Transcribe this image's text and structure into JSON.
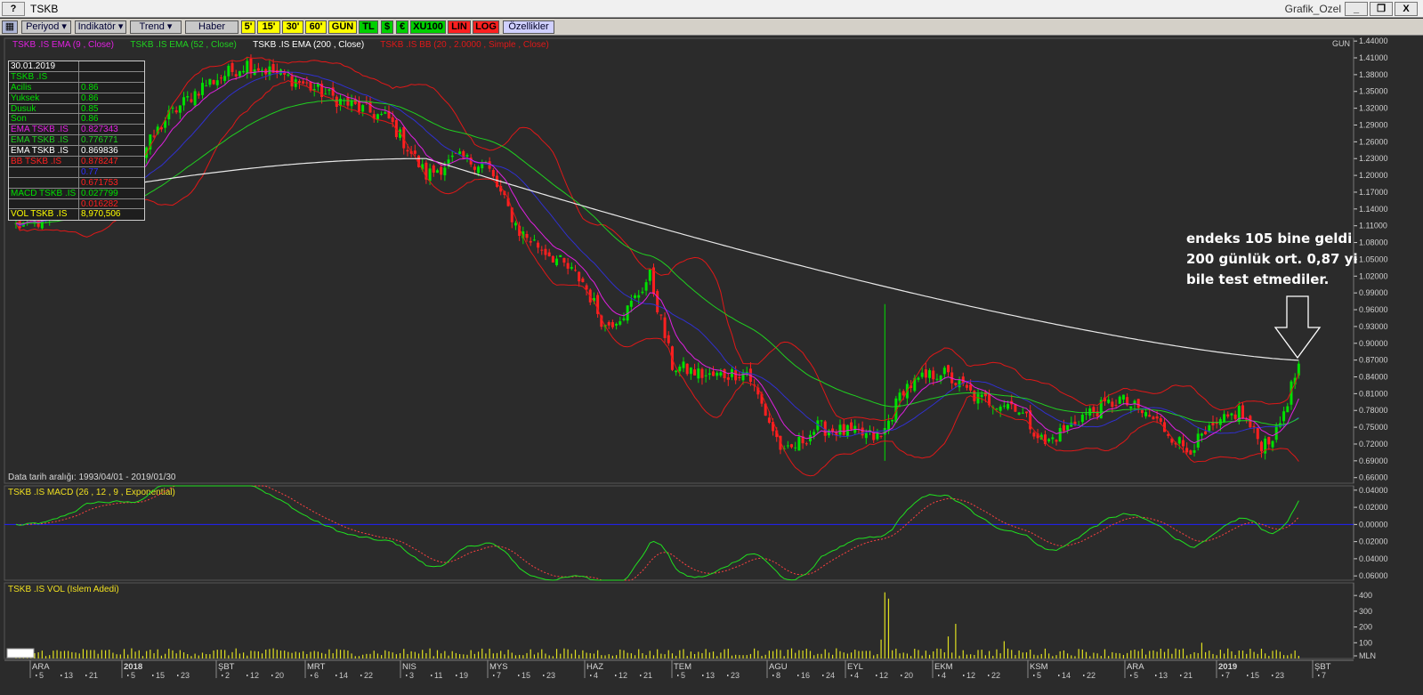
{
  "window": {
    "help_label": "?",
    "title": "TSKB",
    "subtitle": "Grafik_Ozel",
    "minimize_label": "_",
    "restore_label": "❐",
    "close_label": "X"
  },
  "toolbar": {
    "items": [
      {
        "label": "Periyod ▾",
        "style": "gray"
      },
      {
        "label": "Indikatör ▾",
        "style": "gray"
      },
      {
        "label": "Trend ▾",
        "style": "gray"
      },
      {
        "label": "Haber",
        "style": "gray"
      },
      {
        "label": "5'",
        "style": "yellow"
      },
      {
        "label": "15'",
        "style": "yellow"
      },
      {
        "label": "30'",
        "style": "yellow"
      },
      {
        "label": "60'",
        "style": "yellow"
      },
      {
        "label": "GÜN",
        "style": "yellow"
      },
      {
        "label": "TL",
        "style": "green"
      },
      {
        "label": "$",
        "style": "green"
      },
      {
        "label": "€",
        "style": "green"
      },
      {
        "label": "XU100",
        "style": "green"
      },
      {
        "label": "LIN",
        "style": "red"
      },
      {
        "label": "LOG",
        "style": "red"
      },
      {
        "label": "Özellikler",
        "style": "blue"
      }
    ]
  },
  "colors": {
    "bull": "#00e000",
    "bear": "#ff2020",
    "ema9": "#e020e0",
    "ema52": "#20d020",
    "ema200": "#e8e8e8",
    "bb": "#e01818",
    "bbmid": "#3030d0",
    "macd": "#20e020",
    "signal": "#ff4040",
    "zero": "#2020ff",
    "volume": "#e0e020",
    "grid": "#3a3a3a",
    "axis_text": "#d0d0d0"
  },
  "info_box": {
    "rows": [
      {
        "k": "30.01.2019",
        "v": "",
        "kc": "#ffffff",
        "vc": "#ffffff"
      },
      {
        "k": "TSKB .IS",
        "v": "",
        "kc": "#00e000",
        "vc": "#00e000"
      },
      {
        "k": " Acilis",
        "v": "0.86",
        "kc": "#00e000",
        "vc": "#00e000"
      },
      {
        "k": " Yuksek",
        "v": "0.86",
        "kc": "#00e000",
        "vc": "#00e000"
      },
      {
        "k": " Dusuk",
        "v": "0.85",
        "kc": "#00e000",
        "vc": "#00e000"
      },
      {
        "k": " Son",
        "v": "0.86",
        "kc": "#00e000",
        "vc": "#00e000"
      },
      {
        "k": "EMA TSKB .IS",
        "v": "0.827343",
        "kc": "#e020e0",
        "vc": "#e020e0"
      },
      {
        "k": "EMA TSKB .IS",
        "v": "0.776771",
        "kc": "#20d020",
        "vc": "#20d020"
      },
      {
        "k": "EMA TSKB .IS",
        "v": "0.869836",
        "kc": "#ffffff",
        "vc": "#ffffff"
      },
      {
        "k": "BB TSKB .IS",
        "v": "0.878247",
        "kc": "#ff2020",
        "vc": "#ff2020"
      },
      {
        "k": "",
        "v": "0.77",
        "kc": "#3030ff",
        "vc": "#3030ff"
      },
      {
        "k": "",
        "v": "0.671753",
        "kc": "#ff2020",
        "vc": "#ff2020"
      },
      {
        "k": "MACD TSKB .IS",
        "v": "0.027799",
        "kc": "#00e000",
        "vc": "#00e000"
      },
      {
        "k": "",
        "v": "0.016282",
        "kc": "#ff2020",
        "vc": "#ff2020"
      },
      {
        "k": "VOL TSKB .IS",
        "v": "8,970,506",
        "kc": "#ffff00",
        "vc": "#ffff00"
      }
    ]
  },
  "annotation": {
    "lines": [
      "endeks 105 bine geldi",
      "200 günlük ort. 0,87 yi",
      "bile test etmediler."
    ]
  },
  "chart_data": [
    {
      "type": "candlestick",
      "legend": [
        {
          "text": "TSKB .IS EMA (9 , Close)",
          "color": "#e020e0"
        },
        {
          "text": "TSKB .IS EMA (52 , Close)",
          "color": "#20d020"
        },
        {
          "text": "TSKB .IS EMA (200 , Close)",
          "color": "#ffffff"
        },
        {
          "text": "TSKB .IS BB (20 , 2.0000 , Simple , Close)",
          "color": "#e01818"
        }
      ],
      "period_label": "GUN",
      "date_range_text": "Data tarih aralığı: 1993/04/01 - 2019/01/30",
      "ylim": [
        0.65,
        1.445
      ],
      "yticks": [
        "1.44000",
        "1.41000",
        "1.38000",
        "1.35000",
        "1.32000",
        "1.29000",
        "1.26000",
        "1.23000",
        "1.20000",
        "1.17000",
        "1.14000",
        "1.11000",
        "1.08000",
        "1.05000",
        "1.02000",
        "0.99000",
        "0.96000",
        "0.93000",
        "0.90000",
        "0.87000",
        "0.84000",
        "0.81000",
        "0.78000",
        "0.75000",
        "0.72000",
        "0.69000",
        "0.66000"
      ],
      "close_anchors": [
        [
          0,
          1.11
        ],
        [
          8,
          1.12
        ],
        [
          18,
          1.18
        ],
        [
          30,
          1.2
        ],
        [
          40,
          1.3
        ],
        [
          50,
          1.36
        ],
        [
          62,
          1.4
        ],
        [
          75,
          1.37
        ],
        [
          88,
          1.33
        ],
        [
          100,
          1.3
        ],
        [
          110,
          1.2
        ],
        [
          118,
          1.23
        ],
        [
          126,
          1.22
        ],
        [
          135,
          1.1
        ],
        [
          145,
          1.05
        ],
        [
          152,
          1.01
        ],
        [
          158,
          0.93
        ],
        [
          164,
          0.96
        ],
        [
          170,
          1.02
        ],
        [
          176,
          0.86
        ],
        [
          186,
          0.84
        ],
        [
          196,
          0.85
        ],
        [
          206,
          0.7
        ],
        [
          215,
          0.75
        ],
        [
          224,
          0.74
        ],
        [
          232,
          0.73
        ],
        [
          238,
          0.82
        ],
        [
          248,
          0.85
        ],
        [
          258,
          0.8
        ],
        [
          268,
          0.79
        ],
        [
          276,
          0.72
        ],
        [
          286,
          0.77
        ],
        [
          296,
          0.8
        ],
        [
          306,
          0.76
        ],
        [
          314,
          0.71
        ],
        [
          322,
          0.75
        ],
        [
          328,
          0.78
        ],
        [
          334,
          0.72
        ],
        [
          338,
          0.74
        ],
        [
          344,
          0.86
        ]
      ],
      "ema200": {
        "start": 1.15,
        "peak": 1.23,
        "peak_i": 110,
        "end": 0.8698
      },
      "ema52_end": 0.7768,
      "ema9_end": 0.8273,
      "bb_end": {
        "upper": 0.8782,
        "mid": 0.77,
        "lower": 0.6718
      },
      "spikes": [
        [
          233,
          0.97,
          0.69
        ]
      ]
    },
    {
      "type": "line",
      "title": "TSKB .IS MACD (26 , 12 , 9 , Exponential)",
      "ylim": [
        -0.065,
        0.045
      ],
      "yticks": [
        "0.04000",
        "0.02000",
        "0.00000",
        "0.02000",
        "0.04000",
        "0.06000"
      ],
      "ytick_values": [
        0.04,
        0.02,
        0,
        -0.02,
        -0.04,
        -0.06
      ],
      "last": {
        "macd": 0.027799,
        "signal": 0.016282
      }
    },
    {
      "type": "bar",
      "title": "TSKB .IS VOL (Islem Adedi)",
      "ylim": [
        0,
        480
      ],
      "yticks": [
        "400",
        "300",
        "200",
        "100",
        "MLN"
      ],
      "ytick_values": [
        400,
        300,
        200,
        100,
        0
      ],
      "spikes": [
        [
          233,
          420
        ],
        [
          234,
          380
        ],
        [
          232,
          120
        ],
        [
          252,
          220
        ],
        [
          250,
          140
        ],
        [
          265,
          110
        ],
        [
          318,
          100
        ]
      ]
    }
  ],
  "x_axis": {
    "months": [
      {
        "label": "ARA",
        "x": 36,
        "days": [
          "5",
          "13",
          "21"
        ],
        "bold": false
      },
      {
        "label": "2018",
        "x": 139,
        "days": [
          "5",
          "15",
          "23"
        ],
        "bold": true
      },
      {
        "label": "ŞBT",
        "x": 245,
        "days": [
          "2",
          "12",
          "20"
        ],
        "bold": false
      },
      {
        "label": "MRT",
        "x": 345,
        "days": [
          "6",
          "14",
          "22"
        ],
        "bold": false
      },
      {
        "label": "NIS",
        "x": 452,
        "days": [
          "3",
          "11",
          "19"
        ],
        "bold": false
      },
      {
        "label": "MYS",
        "x": 550,
        "days": [
          "7",
          "15",
          "23"
        ],
        "bold": false
      },
      {
        "label": "HAZ",
        "x": 659,
        "days": [
          "4",
          "12",
          "21"
        ],
        "bold": false
      },
      {
        "label": "TEM",
        "x": 757,
        "days": [
          "5",
          "13",
          "23"
        ],
        "bold": false
      },
      {
        "label": "AGU",
        "x": 864,
        "days": [
          "8",
          "16",
          "24"
        ],
        "bold": false
      },
      {
        "label": "EYL",
        "x": 952,
        "days": [
          "4",
          "12",
          "20"
        ],
        "bold": false
      },
      {
        "label": "EKM",
        "x": 1050,
        "days": [
          "4",
          "12",
          "22"
        ],
        "bold": false
      },
      {
        "label": "KSM",
        "x": 1157,
        "days": [
          "5",
          "14",
          "22"
        ],
        "bold": false
      },
      {
        "label": "ARA",
        "x": 1266,
        "days": [
          "5",
          "13",
          "21"
        ],
        "bold": false
      },
      {
        "label": "2019",
        "x": 1369,
        "days": [
          "7",
          "15",
          "23"
        ],
        "bold": true
      },
      {
        "label": "ŞBT",
        "x": 1477,
        "days": [
          "7"
        ],
        "bold": false
      }
    ]
  }
}
